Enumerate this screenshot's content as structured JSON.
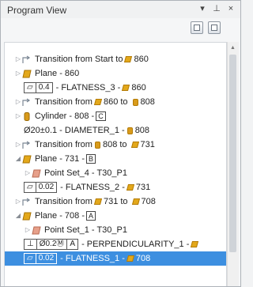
{
  "panel": {
    "title": "Program View",
    "controls": {
      "dropdown": "▾",
      "pin": "⊥",
      "close": "×"
    }
  },
  "tree": {
    "rows": [
      {
        "name": "transition-start-860",
        "label": "Transition from Start to",
        "target": "860",
        "icon": "transition-icon"
      },
      {
        "name": "plane-860",
        "label": "Plane - 860",
        "icon": "plane-icon"
      },
      {
        "name": "flatness-3",
        "fcf": [
          "▱",
          "0.4"
        ],
        "label": "- FLATNESS_3 -",
        "target": "860",
        "icon": "flatness-frame"
      },
      {
        "name": "transition-860-808",
        "label": "Transition from",
        "mid": "860",
        "mid_text": "to",
        "target": "808",
        "icon": "transition-icon"
      },
      {
        "name": "cylinder-808",
        "label": "Cylinder - 808 -",
        "datum": "C",
        "icon": "cylinder-icon"
      },
      {
        "name": "diameter-1",
        "label": "Ø20±0.1 - DIAMETER_1 -",
        "target": "808",
        "icon": "none"
      },
      {
        "name": "transition-808-731",
        "label": "Transition from",
        "mid": "808",
        "mid_text": "to",
        "target": "731",
        "icon": "transition-icon"
      },
      {
        "name": "plane-731",
        "label": "Plane - 731 -",
        "datum": "B",
        "icon": "plane-icon"
      },
      {
        "name": "point-set-4",
        "label": "Point Set_4 - T30_P1",
        "icon": "point-set-icon"
      },
      {
        "name": "flatness-2",
        "fcf": [
          "▱",
          "0.02"
        ],
        "label": "- FLATNESS_2 -",
        "target": "731",
        "icon": "flatness-frame"
      },
      {
        "name": "transition-731-708",
        "label": "Transition from",
        "mid": "731",
        "mid_text": "to",
        "target": "708",
        "icon": "transition-icon"
      },
      {
        "name": "plane-708",
        "label": "Plane - 708 -",
        "datum": "A",
        "icon": "plane-icon"
      },
      {
        "name": "point-set-1",
        "label": "Point Set_1 - T30_P1",
        "icon": "point-set-icon"
      },
      {
        "name": "perpendicularity-1",
        "fcf": [
          "⊥",
          "Ø0.2Ⓜ",
          "A"
        ],
        "label": "- PERPENDICULARITY_1 -",
        "target": "",
        "icon": "perp-frame"
      },
      {
        "name": "flatness-1",
        "fcf": [
          "▱",
          "0.02"
        ],
        "label": "- FLATNESS_1 -",
        "target": "708",
        "icon": "flatness-frame",
        "selected": true
      }
    ]
  },
  "colors": {
    "selection": "#3d8fe0",
    "plane": "#e3a81b",
    "transition": "#c0862b"
  }
}
